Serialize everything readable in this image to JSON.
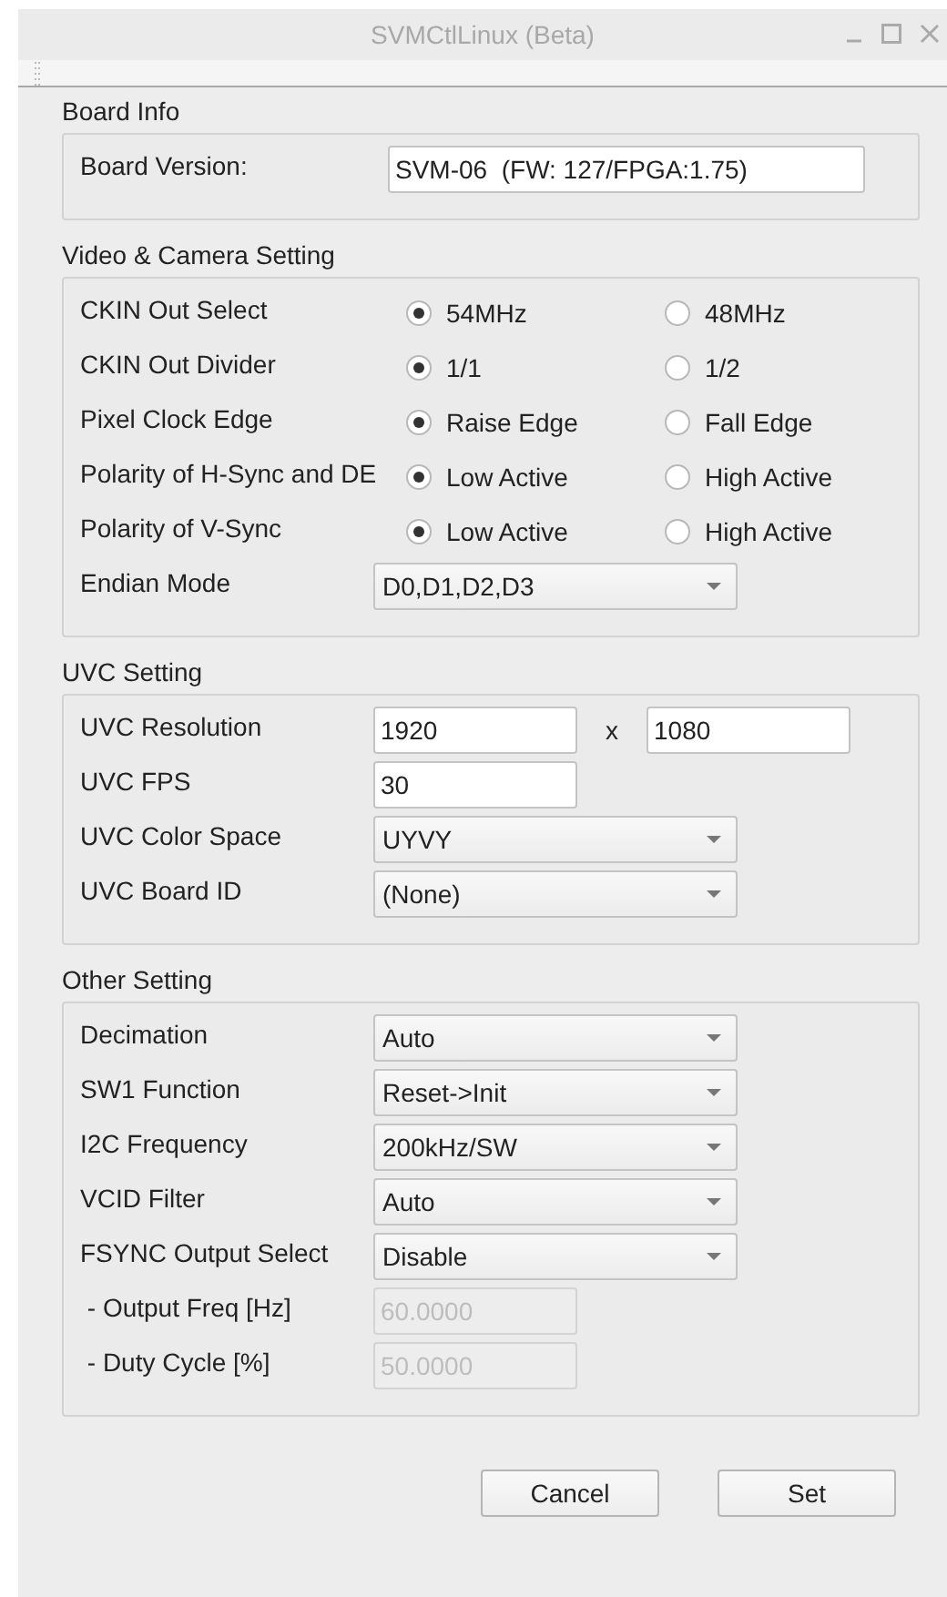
{
  "window": {
    "title": "SVMCtlLinux (Beta)"
  },
  "sections": [
    {
      "title": "Board Info",
      "rows": [
        {
          "kind": "info",
          "label": "Board Version:",
          "value": "SVM-06  (FW: 127/FPGA:1.75)"
        }
      ]
    },
    {
      "title": "Video & Camera Setting",
      "rows": [
        {
          "kind": "radio",
          "label": "CKIN Out Select",
          "options": [
            {
              "label": "54MHz",
              "selected": true
            },
            {
              "label": "48MHz",
              "selected": false
            }
          ]
        },
        {
          "kind": "radio",
          "label": "CKIN Out Divider",
          "options": [
            {
              "label": "1/1",
              "selected": true
            },
            {
              "label": "1/2",
              "selected": false
            }
          ]
        },
        {
          "kind": "radio",
          "label": "Pixel Clock Edge",
          "options": [
            {
              "label": "Raise Edge",
              "selected": true
            },
            {
              "label": "Fall Edge",
              "selected": false
            }
          ]
        },
        {
          "kind": "radio",
          "label": "Polarity of H-Sync and DE",
          "options": [
            {
              "label": "Low Active",
              "selected": true
            },
            {
              "label": "High Active",
              "selected": false
            }
          ]
        },
        {
          "kind": "radio",
          "label": "Polarity of V-Sync",
          "options": [
            {
              "label": "Low Active",
              "selected": true
            },
            {
              "label": "High Active",
              "selected": false
            }
          ]
        },
        {
          "kind": "combo",
          "label": "Endian Mode",
          "value": "D0,D1,D2,D3"
        }
      ]
    },
    {
      "title": "UVC Setting",
      "rows": [
        {
          "kind": "pair",
          "label": "UVC Resolution",
          "values": [
            "1920",
            "1080"
          ],
          "separator": "x"
        },
        {
          "kind": "text",
          "label": "UVC FPS",
          "value": "30",
          "disabled": false
        },
        {
          "kind": "combo",
          "label": "UVC Color Space",
          "value": "UYVY"
        },
        {
          "kind": "combo",
          "label": "UVC Board ID",
          "value": "(None)"
        }
      ]
    },
    {
      "title": "Other Setting",
      "rows": [
        {
          "kind": "combo",
          "label": "Decimation",
          "value": "Auto"
        },
        {
          "kind": "combo",
          "label": "SW1 Function",
          "value": "Reset->Init"
        },
        {
          "kind": "combo",
          "label": "I2C Frequency",
          "value": "200kHz/SW"
        },
        {
          "kind": "combo",
          "label": "VCID Filter",
          "value": "Auto"
        },
        {
          "kind": "combo",
          "label": "FSYNC Output Select",
          "value": "Disable"
        },
        {
          "kind": "text",
          "label": " - Output Freq [Hz]",
          "value": "60.0000",
          "disabled": true
        },
        {
          "kind": "text",
          "label": " - Duty Cycle [%]",
          "value": "50.0000",
          "disabled": true
        }
      ]
    }
  ],
  "buttons": [
    {
      "label": "Cancel"
    },
    {
      "label": "Set"
    }
  ]
}
